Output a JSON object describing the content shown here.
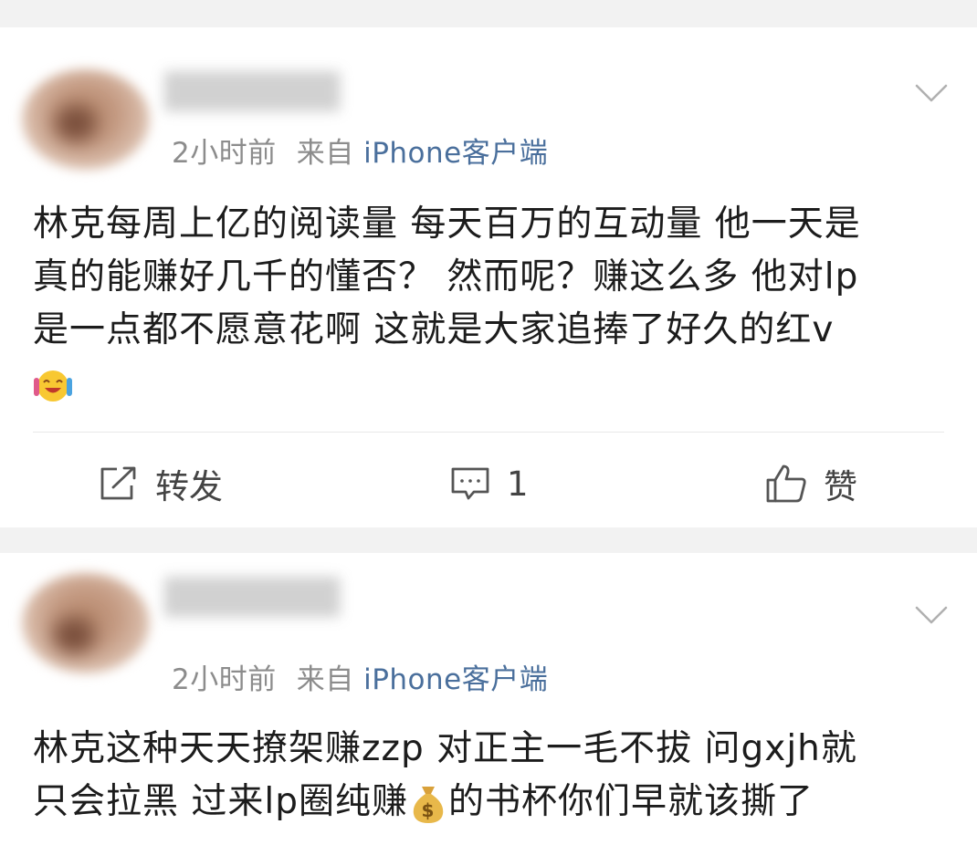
{
  "posts": [
    {
      "time": "2小时前",
      "source_prefix": "来自",
      "source": "iPhone客户端",
      "lines": [
        "林克每周上亿的阅读量 每天百万的互动量 他一天是",
        "真的能赚好几千的懂否？ 然而呢？赚这么多 他对lp",
        "是一点都不愿意花啊 这就是大家追捧了好久的红v"
      ],
      "actions": {
        "repost_label": "转发",
        "comment_count": "1",
        "like_label": "赞"
      }
    },
    {
      "time": "2小时前",
      "source_prefix": "来自",
      "source": "iPhone客户端",
      "lines": [
        "林克这种天天撩架赚zzp 对正主一毛不拔 问gxjh就",
        "只会拉黑 过来lp圈纯赚",
        "的书杯你们早就该撕了"
      ]
    }
  ],
  "icons": {
    "more": "chevron-down-icon",
    "repost": "share-icon",
    "comment": "comment-icon",
    "like": "thumbs-up-icon",
    "emoji1": "laughing-crying-emoji",
    "emoji2": "money-bag-emoji"
  },
  "colors": {
    "link": "#4a6f9c",
    "meta": "#8c8c8c",
    "text": "#1c1c1c",
    "background": "#f2f2f2"
  }
}
